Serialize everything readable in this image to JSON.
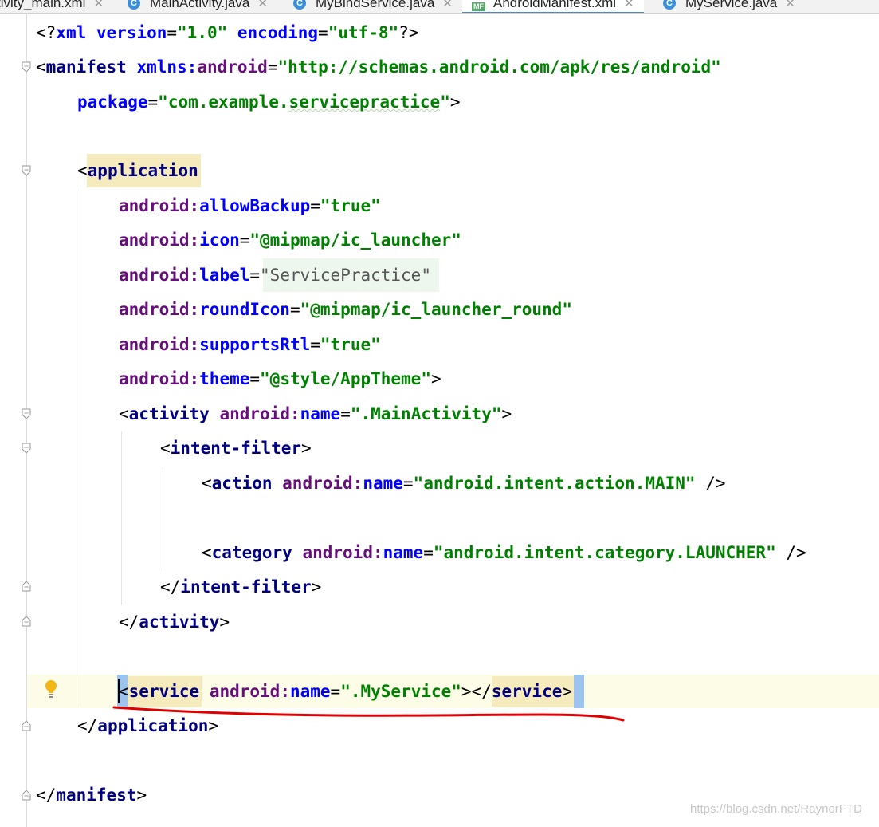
{
  "tabs": [
    {
      "label": "tivity_main.xml",
      "icon": "xml-file-icon",
      "active": false
    },
    {
      "label": "MainActivity.java",
      "icon": "java-class-icon",
      "active": false
    },
    {
      "label": "MyBindService.java",
      "icon": "java-class-icon",
      "active": false
    },
    {
      "label": "AndroidManifest.xml",
      "icon": "manifest-file-icon",
      "active": true,
      "badge": "MF"
    },
    {
      "label": "MyService.java",
      "icon": "java-class-icon",
      "active": false
    }
  ],
  "code": {
    "l1": {
      "p1": "<?",
      "p2": "xml version",
      "p3": "=",
      "p4": "\"1.0\"",
      "p5": " encoding",
      "p6": "=",
      "p7": "\"utf-8\"",
      "p8": "?>"
    },
    "l2": {
      "p1": "<",
      "p2": "manifest",
      "p3": " xmlns:",
      "p4": "android",
      "p5": "=",
      "p6": "\"http://schemas.android.com/apk/res/android\""
    },
    "l3": {
      "p1": "package",
      "p2": "=",
      "p3": "\"com.example.",
      "p4": "servicepractice",
      "p5": "\"",
      "p6": ">"
    },
    "l5": {
      "p1": "<",
      "p2": "application"
    },
    "l6": {
      "p1": "android:",
      "p2": "allowBackup",
      "p3": "=",
      "p4": "\"true\""
    },
    "l7": {
      "p1": "android:",
      "p2": "icon",
      "p3": "=",
      "p4": "\"@mipmap/ic_launcher\""
    },
    "l8": {
      "p1": "android:",
      "p2": "label",
      "p3": "=",
      "p4": "\"ServicePractice\""
    },
    "l9": {
      "p1": "android:",
      "p2": "roundIcon",
      "p3": "=",
      "p4": "\"@mipmap/ic_launcher_round\""
    },
    "l10": {
      "p1": "android:",
      "p2": "supportsRtl",
      "p3": "=",
      "p4": "\"true\""
    },
    "l11": {
      "p1": "android:",
      "p2": "theme",
      "p3": "=",
      "p4": "\"@style/AppTheme\"",
      "p5": ">"
    },
    "l12": {
      "p1": "<",
      "p2": "activity",
      "p3": " android:",
      "p4": "name",
      "p5": "=",
      "p6": "\".MainActivity\"",
      "p7": ">"
    },
    "l13": {
      "p1": "<",
      "p2": "intent-filter",
      "p3": ">"
    },
    "l14": {
      "p1": "<",
      "p2": "action",
      "p3": " android:",
      "p4": "name",
      "p5": "=",
      "p6": "\"android.intent.action.MAIN\"",
      "p7": " />"
    },
    "l16": {
      "p1": "<",
      "p2": "category",
      "p3": " android:",
      "p4": "name",
      "p5": "=",
      "p6": "\"android.intent.category.LAUNCHER\"",
      "p7": " />"
    },
    "l17": {
      "p1": "</",
      "p2": "intent-filter",
      "p3": ">"
    },
    "l18": {
      "p1": "</",
      "p2": "activity",
      "p3": ">"
    },
    "l20": {
      "p1": "<",
      "p2": "service",
      "p3": " android:",
      "p4": "name",
      "p5": "=",
      "p6": "\".MyService\"",
      "p7": "></",
      "p8": "service",
      "p9": ">"
    },
    "l21": {
      "p1": "</",
      "p2": "application",
      "p3": ">"
    },
    "l23": {
      "p1": "</",
      "p2": "manifest",
      "p3": ">"
    }
  },
  "watermark": "https://blog.csdn.net/RaynorFTD",
  "colors": {
    "tag": "#000080",
    "attribute_ns": "#660e7a",
    "attribute_name": "#0000ff",
    "value": "#008000",
    "annotation": "#e00000"
  }
}
